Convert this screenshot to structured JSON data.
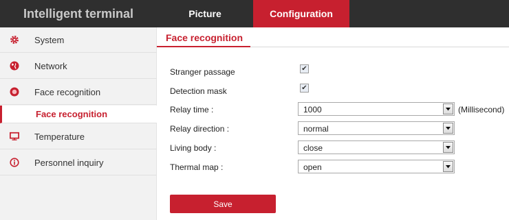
{
  "header": {
    "brand": "Intelligent terminal",
    "tabs": [
      {
        "label": "Picture"
      },
      {
        "label": "Configuration"
      }
    ]
  },
  "sidebar": {
    "items": [
      {
        "label": "System",
        "icon": "gear-icon"
      },
      {
        "label": "Network",
        "icon": "globe-icon"
      },
      {
        "label": "Face recognition",
        "icon": "face-icon"
      },
      {
        "label": "Face recognition"
      },
      {
        "label": "Temperature",
        "icon": "monitor-icon"
      },
      {
        "label": "Personnel inquiry",
        "icon": "info-icon"
      }
    ]
  },
  "main": {
    "title": "Face recognition",
    "fields": {
      "stranger_passage": {
        "label": "Stranger passage",
        "checked": true
      },
      "detection_mask": {
        "label": "Detection mask",
        "checked": true
      },
      "relay_time": {
        "label": "Relay time :",
        "value": "1000",
        "unit": "(Millisecond)"
      },
      "relay_direction": {
        "label": "Relay direction :",
        "value": "normal"
      },
      "living_body": {
        "label": "Living body :",
        "value": "close"
      },
      "thermal_map": {
        "label": "Thermal map :",
        "value": "open"
      }
    },
    "save_label": "Save"
  },
  "colors": {
    "accent": "#c7202f",
    "topbar": "#2f2f2f",
    "sidebar": "#f2f2f2"
  }
}
